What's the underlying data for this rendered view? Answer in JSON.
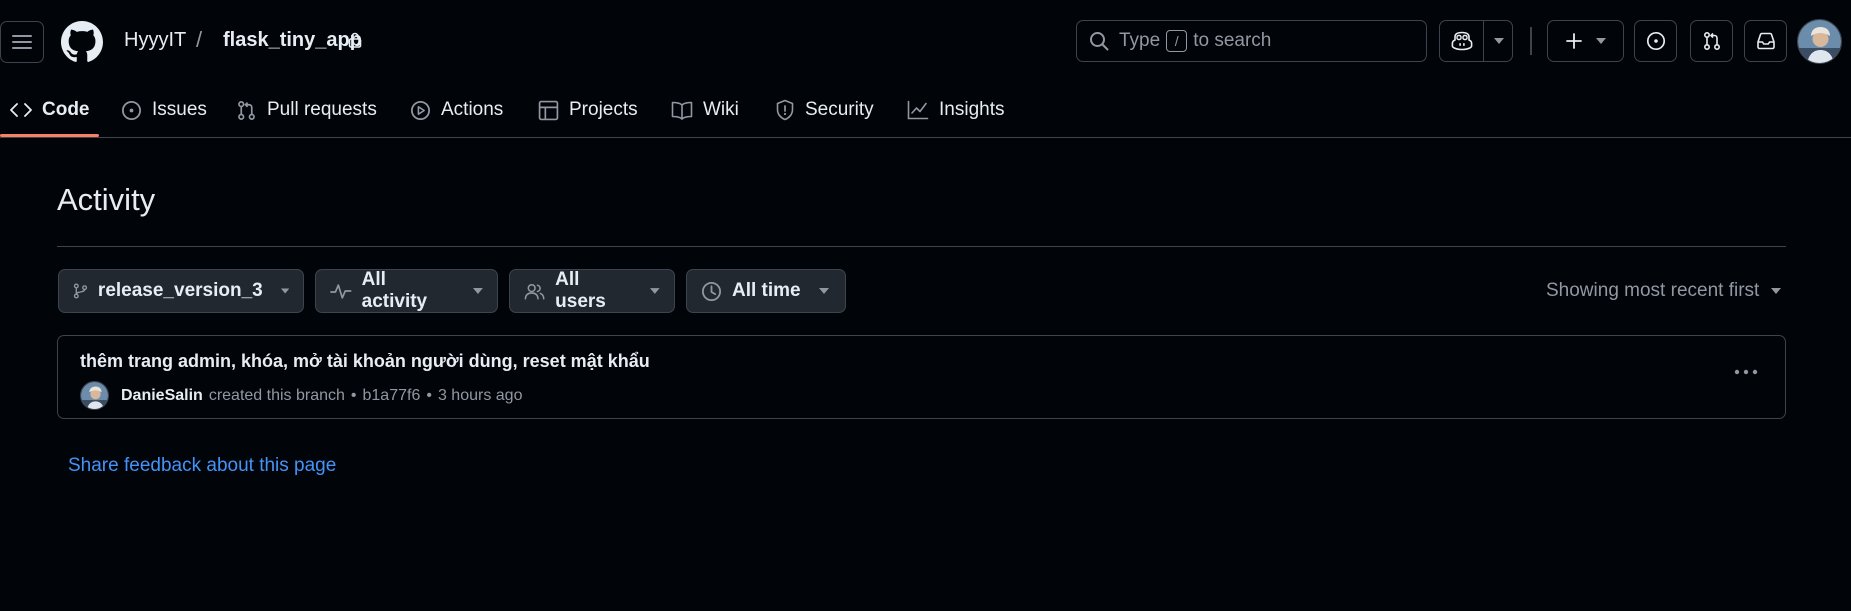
{
  "header": {
    "owner": "HyyyIT",
    "separator": "/",
    "repo": "flask_tiny_app",
    "search": {
      "prefix": "Type",
      "key": "/",
      "suffix": "to search"
    }
  },
  "icons": {
    "menu": "hamburger-icon",
    "logo": "github-mark-icon",
    "lock": "lock-icon",
    "search": "search-icon",
    "copilot": "copilot-icon",
    "plus": "plus-icon",
    "issues": "issue-opened-icon",
    "pulls": "git-pull-request-icon",
    "inbox": "inbox-icon"
  },
  "reponav": {
    "tabs": [
      {
        "label": "Code",
        "icon": "code-icon",
        "active": true
      },
      {
        "label": "Issues",
        "icon": "issue-opened-icon"
      },
      {
        "label": "Pull requests",
        "icon": "git-pull-request-icon"
      },
      {
        "label": "Actions",
        "icon": "play-icon"
      },
      {
        "label": "Projects",
        "icon": "table-icon"
      },
      {
        "label": "Wiki",
        "icon": "book-icon"
      },
      {
        "label": "Security",
        "icon": "shield-icon"
      },
      {
        "label": "Insights",
        "icon": "graph-icon"
      }
    ]
  },
  "main": {
    "title": "Activity",
    "filters": {
      "branch": "release_version_3",
      "activity": "All activity",
      "users": "All users",
      "time": "All time"
    },
    "sort_label": "Showing most recent first",
    "activity": {
      "message": "thêm trang admin, khóa, mở tài khoản người dùng, reset mật khẩu",
      "user": "DanieSalin",
      "action": "created this branch",
      "bullet": "•",
      "commit": "b1a77f6",
      "time": "3 hours ago"
    },
    "feedback_link": "Share feedback about this page"
  },
  "colors": {
    "background": "#010409",
    "border": "#3d444d",
    "text": "#e6edf3",
    "muted": "#9198a1",
    "link": "#4493f8",
    "active_underline": "#f78166",
    "button_bg": "#212830"
  }
}
